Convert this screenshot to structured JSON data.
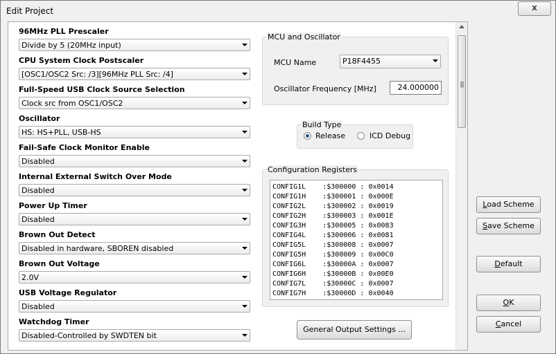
{
  "window": {
    "title": "Edit Project",
    "close_label": "x"
  },
  "settings": [
    {
      "label": "96MHz PLL Prescaler",
      "value": "Divide by 5 (20MHz input)"
    },
    {
      "label": "CPU System Clock Postscaler",
      "value": "[OSC1/OSC2 Src: /3][96MHz PLL Src: /4]"
    },
    {
      "label": "Full-Speed USB Clock Source Selection",
      "value": "Clock src from OSC1/OSC2"
    },
    {
      "label": "Oscillator",
      "value": "HS: HS+PLL, USB-HS"
    },
    {
      "label": "Fail-Safe Clock Monitor Enable",
      "value": "Disabled"
    },
    {
      "label": "Internal External Switch Over Mode",
      "value": "Disabled"
    },
    {
      "label": "Power Up Timer",
      "value": "Disabled"
    },
    {
      "label": "Brown Out Detect",
      "value": "Disabled in hardware, SBOREN disabled"
    },
    {
      "label": "Brown Out Voltage",
      "value": "2.0V"
    },
    {
      "label": "USB Voltage Regulator",
      "value": "Disabled"
    },
    {
      "label": "Watchdog Timer",
      "value": "Disabled-Controlled by SWDTEN bit"
    }
  ],
  "mcu": {
    "group_title": "MCU and Oscillator",
    "name_label": "MCU Name",
    "name_value": "P18F4455",
    "freq_label": "Oscillator Frequency [MHz]",
    "freq_value": "24.000000"
  },
  "build": {
    "group_title": "Build Type",
    "release_label": "Release",
    "release_checked": true,
    "icd_label": "ICD Debug",
    "icd_checked": false
  },
  "registers": {
    "group_title": "Configuration Registers",
    "lines": [
      "CONFIG1L    :$300000 : 0x0014",
      "CONFIG1H    :$300001 : 0x000E",
      "CONFIG2L    :$300002 : 0x0019",
      "CONFIG2H    :$300003 : 0x001E",
      "CONFIG3H    :$300005 : 0x0083",
      "CONFIG4L    :$300006 : 0x0081",
      "CONFIG5L    :$300008 : 0x0007",
      "CONFIG5H    :$300009 : 0x00C0",
      "CONFIG6L    :$30000A : 0x0007",
      "CONFIG6H    :$30000B : 0x00E0",
      "CONFIG7L    :$30000C : 0x0007",
      "CONFIG7H    :$30000D : 0x0040"
    ]
  },
  "buttons": {
    "general_output": "General Output Settings ...",
    "load_scheme": {
      "ul": "L",
      "rest": "oad Scheme"
    },
    "save_scheme": {
      "ul": "S",
      "rest": "ave Scheme"
    },
    "default": {
      "ul": "D",
      "rest": "efault"
    },
    "ok": {
      "ul": "O",
      "rest": "K"
    },
    "cancel": {
      "ul": "C",
      "rest": "ancel"
    }
  }
}
